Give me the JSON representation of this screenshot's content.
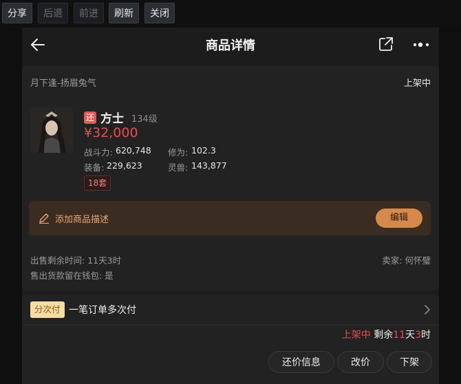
{
  "toolbar": {
    "share": "分享",
    "back": "后退",
    "forward": "前进",
    "refresh": "刷新",
    "close": "关闭"
  },
  "header": {
    "title": "商品详情"
  },
  "listing": {
    "server": "月下逢-扬眉兔气",
    "status": "上架中",
    "badge": "还",
    "name": "方士",
    "level": "134级",
    "price": "¥32,000",
    "stats": {
      "combat_label": "战斗力:",
      "combat_value": "620,748",
      "cultivation_label": "修为:",
      "cultivation_value": "102.3",
      "equipment_label": "装备:",
      "equipment_value": "229,623",
      "pet_label": "灵兽:",
      "pet_value": "143,877"
    },
    "sets": "18套",
    "desc_label": "添加商品描述",
    "edit_label": "编辑",
    "sale_time": "出售剩余时间: 11天3时",
    "wallet": "售出货款留在钱包: 是",
    "seller": "卖家: 何怀璧"
  },
  "installment": {
    "badge": "分次付",
    "text": "一笔订单多次付"
  },
  "footer_status": {
    "status": "上架中",
    "remaining_prefix": "剩余",
    "days": "11",
    "day_unit": "天",
    "hours": "3",
    "hour_unit": "时"
  },
  "actions": {
    "counter_offer": "还价信息",
    "change_price": "改价",
    "delist": "下架"
  },
  "colors": {
    "accent_red": "#ea4c4c",
    "edit_button": "#d58a4b",
    "desc_bar": "#3a2c21",
    "panel": "#1c1c1c"
  },
  "icons": [
    "back-arrow-icon",
    "share-external-icon",
    "more-dots-icon",
    "pencil-icon",
    "chevron-right-icon"
  ]
}
